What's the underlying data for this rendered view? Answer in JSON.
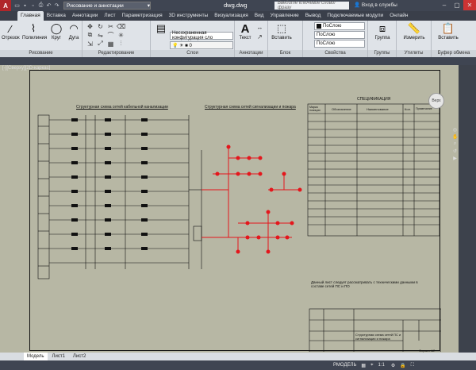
{
  "app": {
    "logo": "A",
    "workspace": "Рисование и аннотации",
    "title": "dwg.dwg",
    "search_placeholder": "Введите ключевое слово/фразу",
    "login": "Вход в службы"
  },
  "tabs": [
    {
      "label": "Главная",
      "active": true
    },
    {
      "label": "Вставка"
    },
    {
      "label": "Аннотации"
    },
    {
      "label": "Лист"
    },
    {
      "label": "Параметризация"
    },
    {
      "label": "3D инструменты"
    },
    {
      "label": "Визуализация"
    },
    {
      "label": "Вид"
    },
    {
      "label": "Управление"
    },
    {
      "label": "Вывод"
    },
    {
      "label": "Подключаемые модули"
    },
    {
      "label": "Онлайн"
    }
  ],
  "ribbon": {
    "draw": {
      "label": "Рисование",
      "line": "Отрезок",
      "polyline": "Полилиния",
      "circle": "Круг",
      "arc": "Дуга"
    },
    "modify": {
      "label": "Редактирование"
    },
    "layers": {
      "label": "Слои",
      "layer_state": "Несохраненная конфигурация сло"
    },
    "annotation": {
      "label": "Аннотации",
      "text": "Текст"
    },
    "block": {
      "label": "Блок",
      "insert": "Вставить"
    },
    "properties": {
      "label": "Свойства",
      "color": "ПоСлою",
      "linetype": "ПоСлою",
      "lineweight": "ПоСлою"
    },
    "groups": {
      "label": "Группы",
      "group": "Группа"
    },
    "utilities": {
      "label": "Утилиты",
      "measure": "Измерить"
    },
    "clipboard": {
      "label": "Буфер обмена",
      "paste": "Вставить"
    }
  },
  "viewport": {
    "label": "[-][Сверху][2D-каркас]",
    "viewcube": "Верх"
  },
  "drawing": {
    "left_title": "Структурная схема сетей кабельной канализации",
    "mid_title": "Структурная схема сетей сигнализации и пожара",
    "spec_title": "СПЕЦИФИКАЦИЯ",
    "spec_header": [
      "Марка позиции",
      "Обозначение",
      "Наименование",
      "Кол.",
      "Примечание"
    ],
    "note": "Данный лист следует рассматривать с техническими данными в составе сетей ПС и ПО",
    "stamp_title": "Структурная схема сетей ПС и сигнализации и пожара",
    "format": "Формат А2"
  },
  "sheets": [
    {
      "label": "Модель",
      "active": true
    },
    {
      "label": "Лист1"
    },
    {
      "label": "Лист2"
    }
  ],
  "status": {
    "mode": "РМОДЕЛЬ",
    "scale": "1:1"
  },
  "colors": {
    "red": "#e4161c",
    "paper": "#b7b7a4",
    "ink": "#111111"
  }
}
